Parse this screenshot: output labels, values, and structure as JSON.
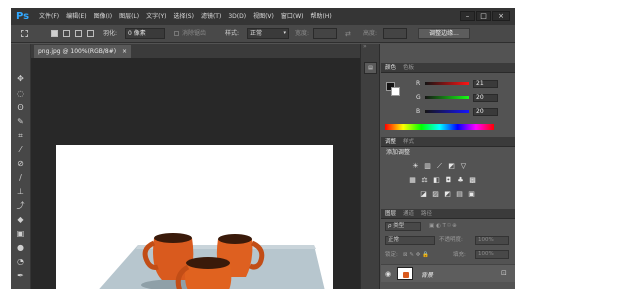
{
  "app": {
    "logo": "Ps"
  },
  "menu": [
    "文件(F)",
    "编辑(E)",
    "图像(I)",
    "图层(L)",
    "文字(Y)",
    "选择(S)",
    "滤镜(T)",
    "3D(D)",
    "视图(V)",
    "窗口(W)",
    "帮助(H)"
  ],
  "window_controls": {
    "minimize": "–",
    "maximize": "□",
    "close": "×"
  },
  "options_bar": {
    "feather_label": "羽化:",
    "feather_value": "0 像素",
    "antialias_label": "消除锯齿",
    "style_label": "样式:",
    "style_value": "正常",
    "width_label": "宽度:",
    "height_label": "高度:",
    "refine_edge_button": "调整边缘..."
  },
  "document": {
    "tab_title": "png.jpg @ 100%(RGB/8#)",
    "tab_close": "×"
  },
  "color_panel": {
    "tabs": [
      "颜色",
      "色板"
    ],
    "channels": [
      {
        "label": "R",
        "value": "21",
        "color": "#e02020"
      },
      {
        "label": "G",
        "value": "20",
        "color": "#20c020"
      },
      {
        "label": "B",
        "value": "20",
        "color": "#3050e0"
      }
    ]
  },
  "adjustments_panel": {
    "tabs": [
      "调整",
      "样式"
    ],
    "title": "添加调整"
  },
  "layers_panel": {
    "tabs": [
      "图层",
      "通道",
      "路径"
    ],
    "filter_label": "ρ 类型",
    "blend_mode": "正常",
    "opacity_label": "不透明度:",
    "opacity_value": "100%",
    "lock_label": "锁定:",
    "fill_label": "填充:",
    "fill_value": "100%",
    "layer_name": "背景"
  },
  "colors": {
    "accent": "#31a8ff",
    "cup": "#d95a1e",
    "panel_bg": "#535353"
  }
}
